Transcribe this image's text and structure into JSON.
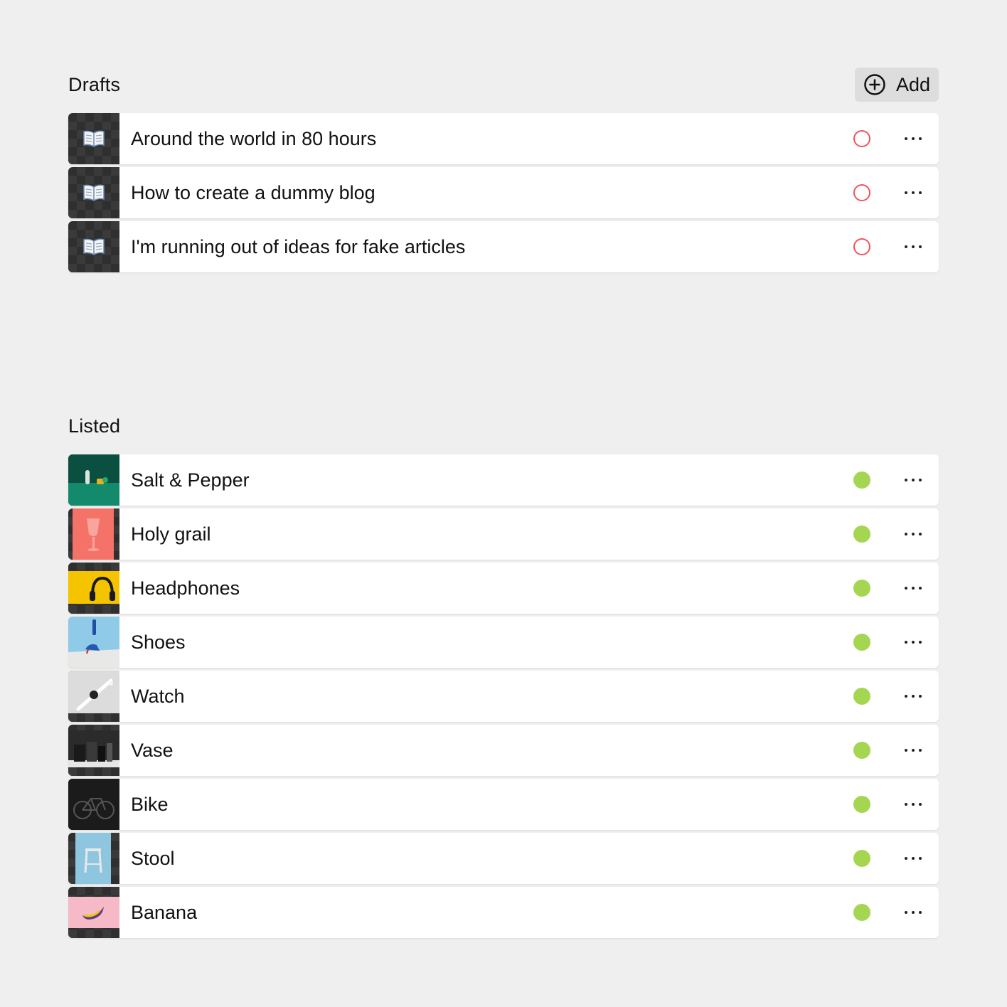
{
  "drafts": {
    "title": "Drafts",
    "add_label": "Add",
    "add_icon": "plus-circle-icon",
    "status_color": "#f0545d",
    "items": [
      {
        "title": "Around the world in 80 hours",
        "icon": "open-book-icon",
        "status": "draft"
      },
      {
        "title": "How to create a dummy blog",
        "icon": "open-book-icon",
        "status": "draft"
      },
      {
        "title": "I'm running out of ideas for fake articles",
        "icon": "open-book-icon",
        "status": "draft"
      }
    ]
  },
  "listed": {
    "title": "Listed",
    "status_color": "#a5d651",
    "items": [
      {
        "title": "Salt & Pepper",
        "thumbnail": "salt-pepper-thumbnail",
        "status": "listed"
      },
      {
        "title": "Holy grail",
        "thumbnail": "holy-grail-thumbnail",
        "status": "listed"
      },
      {
        "title": "Headphones",
        "thumbnail": "headphones-thumbnail",
        "status": "listed"
      },
      {
        "title": "Shoes",
        "thumbnail": "shoes-thumbnail",
        "status": "listed"
      },
      {
        "title": "Watch",
        "thumbnail": "watch-thumbnail",
        "status": "listed"
      },
      {
        "title": "Vase",
        "thumbnail": "vase-thumbnail",
        "status": "listed"
      },
      {
        "title": "Bike",
        "thumbnail": "bike-thumbnail",
        "status": "listed"
      },
      {
        "title": "Stool",
        "thumbnail": "stool-thumbnail",
        "status": "listed"
      },
      {
        "title": "Banana",
        "thumbnail": "banana-thumbnail",
        "status": "listed"
      }
    ]
  },
  "row_action_icon": "more-horizontal-icon"
}
